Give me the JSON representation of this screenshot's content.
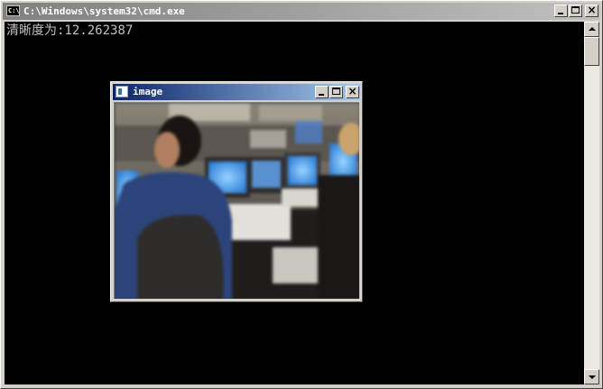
{
  "console": {
    "title": "C:\\Windows\\system32\\cmd.exe",
    "output_line": "清晰度为:12.262387"
  },
  "image_window": {
    "title": "image"
  },
  "colors": {
    "console_bg": "#000000",
    "console_text": "#c0c0c0",
    "inactive_title": "#808080",
    "active_title": "#0a246a",
    "chrome": "#d4d0c8"
  },
  "icons": [
    "cmd-icon",
    "minimize-icon",
    "maximize-icon",
    "close-icon",
    "scroll-up-icon",
    "scroll-down-icon",
    "window-icon"
  ]
}
